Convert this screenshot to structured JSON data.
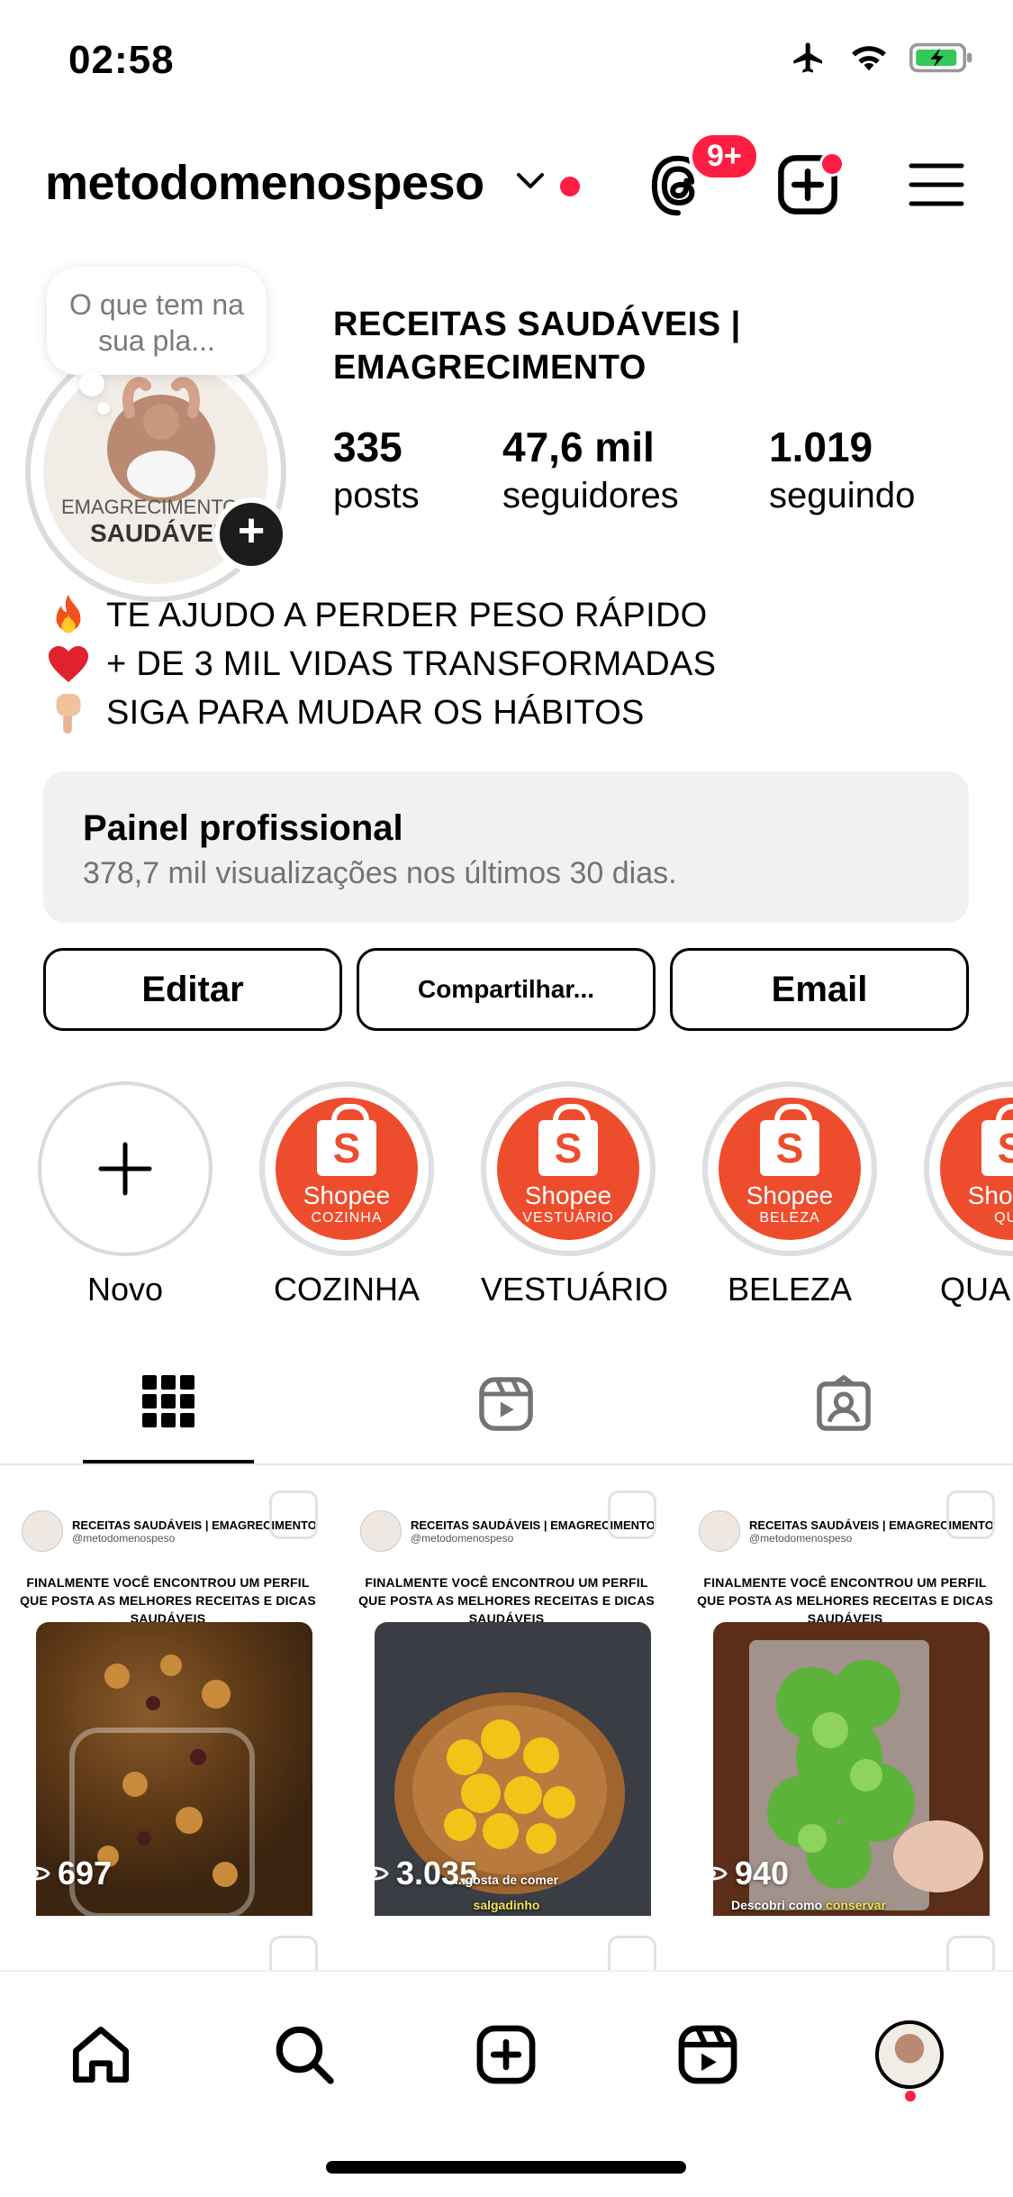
{
  "status_bar": {
    "time": "02:58"
  },
  "header": {
    "username": "metodomenospeso",
    "threads_badge": "9+"
  },
  "profile": {
    "note_text": "O que tem na sua pla...",
    "avatar_text_top": "EMAGRECIMENTO",
    "avatar_text_bottom": "SAUDÁVEIS",
    "display_name": "RECEITAS SAUDÁVEIS | EMAGRECIMENTO",
    "stats": [
      {
        "value": "335",
        "label": "posts"
      },
      {
        "value": "47,6 mil",
        "label": "seguidores"
      },
      {
        "value": "1.019",
        "label": "seguindo"
      }
    ],
    "bio": [
      {
        "icon": "fire-emoji",
        "text": "TE AJUDO A PERDER PESO RÁPIDO"
      },
      {
        "icon": "heart-emoji",
        "text": "+ DE 3 MIL VIDAS TRANSFORMADAS"
      },
      {
        "icon": "pointing-down-emoji",
        "text": "SIGA PARA MUDAR OS HÁBITOS"
      }
    ]
  },
  "dashboard": {
    "title": "Painel profissional",
    "subtitle": "378,7 mil visualizações nos últimos 30 dias."
  },
  "buttons": {
    "edit": "Editar",
    "share": "Compartilhar...",
    "email": "Email"
  },
  "highlights": {
    "new_label": "Novo",
    "brand": "Shopee",
    "items": [
      {
        "label": "COZINHA",
        "sub": "COZINHA"
      },
      {
        "label": "VESTUÁRIO",
        "sub": "VESTUÁRIO"
      },
      {
        "label": "BELEZA",
        "sub": "BELEZA"
      },
      {
        "label": "QUA",
        "sub": "QUA"
      }
    ]
  },
  "grid": {
    "posts": [
      {
        "account": "RECEITAS SAUDÁVEIS | EMAGRECIMENTO",
        "handle": "@metodomenospeso",
        "headline": "FINALMENTE VOCÊ ENCONTROU UM PERFIL QUE POSTA AS MELHORES RECEITAS E DICAS SAUDÁVEIS",
        "views": "697",
        "caption": "",
        "caption_highlight": ""
      },
      {
        "account": "RECEITAS SAUDÁVEIS | EMAGRECIMENTO",
        "handle": "@metodomenospeso",
        "headline": "FINALMENTE VOCÊ ENCONTROU UM PERFIL QUE POSTA AS MELHORES RECEITAS E DICAS SAUDÁVEIS",
        "views": "3.035",
        "caption": "...gosta de comer",
        "caption_highlight": "salgadinho"
      },
      {
        "account": "RECEITAS SAUDÁVEIS | EMAGRECIMENTO",
        "handle": "@metodomenospeso",
        "headline": "FINALMENTE VOCÊ ENCONTROU UM PERFIL QUE POSTA AS MELHORES RECEITAS E DICAS SAUDÁVEIS",
        "views": "940",
        "caption": "Descobri como",
        "caption_highlight": "conservar"
      }
    ]
  },
  "colors": {
    "accent_red": "#ff1d41",
    "shopee_orange": "#ee4d2d",
    "dashboard_bg": "#f0f1f3"
  }
}
